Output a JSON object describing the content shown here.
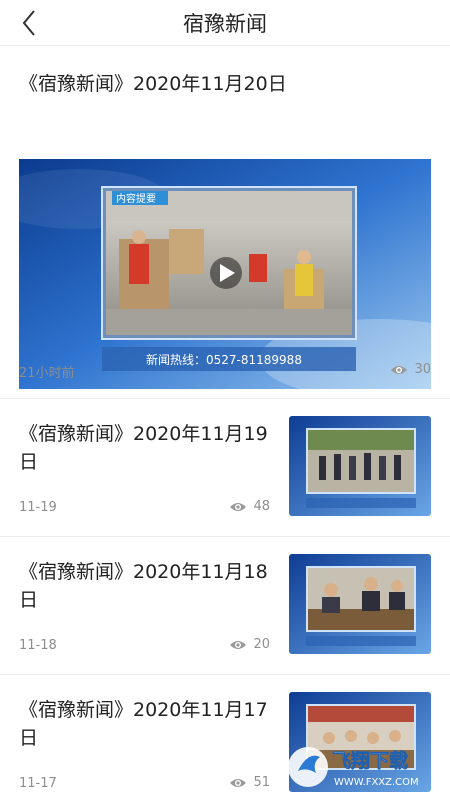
{
  "header": {
    "title": "宿豫新闻"
  },
  "featured": {
    "title": "《宿豫新闻》2020年11月20日",
    "video_badge": "内容提要",
    "hotline": "新闻热线：0527-81189988",
    "time": "21小时前",
    "views": "30"
  },
  "items": [
    {
      "title": "《宿豫新闻》2020年11月19日",
      "date": "11-19",
      "views": "48"
    },
    {
      "title": "《宿豫新闻》2020年11月18日",
      "date": "11-18",
      "views": "20"
    },
    {
      "title": "《宿豫新闻》2020年11月17日",
      "date": "11-17",
      "views": "51"
    }
  ],
  "watermark": {
    "text": "飞翔下载",
    "url": "WWW.FXXZ.COM"
  },
  "colors": {
    "accent_blue": "#1a5cb8",
    "muted_text": "#8e8e8e",
    "divider": "#ececec"
  }
}
